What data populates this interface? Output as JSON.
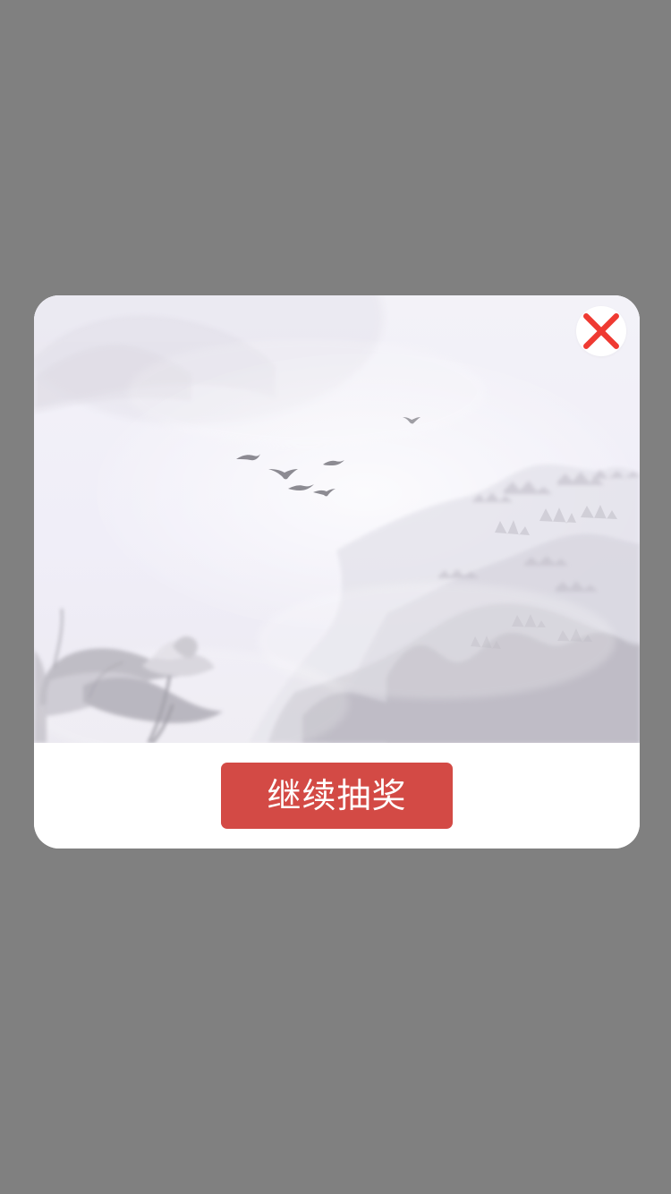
{
  "dialog": {
    "action_label": "继续抽奖"
  },
  "icons": {
    "close": "close-icon"
  },
  "colors": {
    "page_background": "#808080",
    "dialog_background": "#ffffff",
    "button_background": "#d34a45",
    "button_text": "#ffffff",
    "close_icon": "#ef3a32"
  }
}
